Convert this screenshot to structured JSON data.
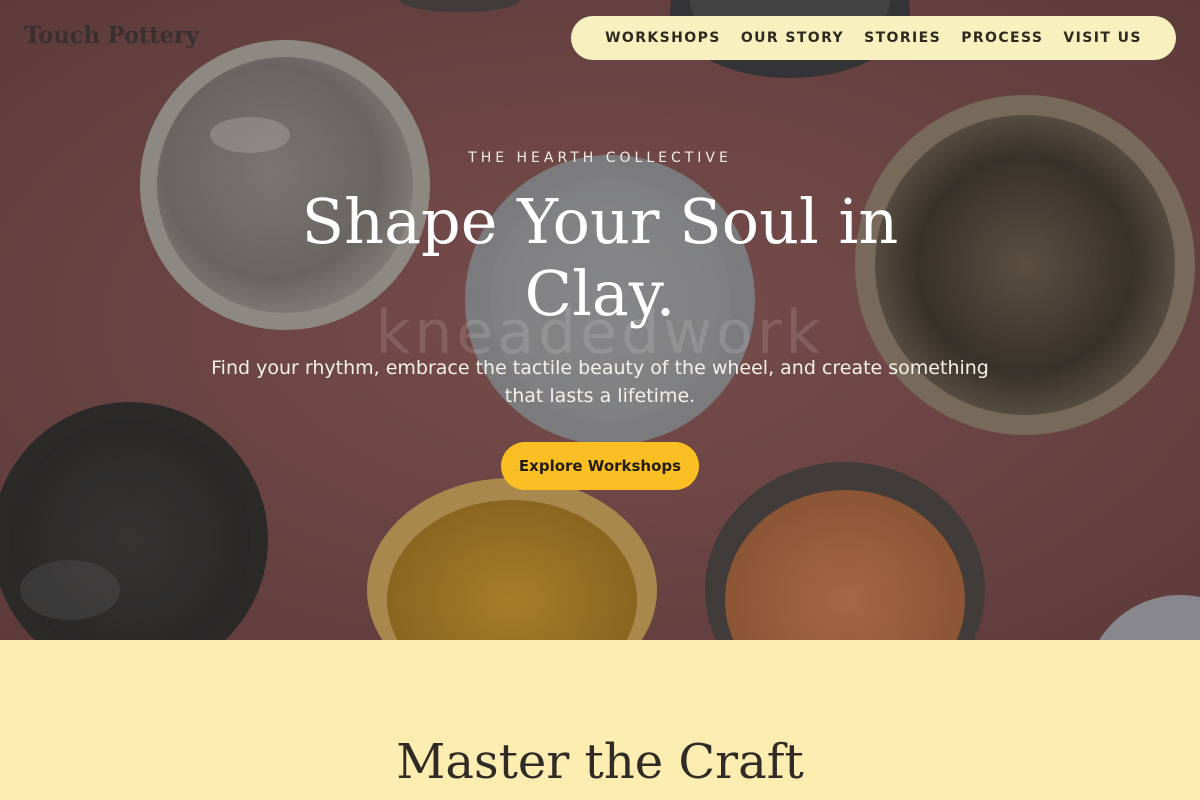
{
  "colors": {
    "nav_background": "#f8f1bf",
    "cta_background": "#fbbf24",
    "section_background": "#feedb0",
    "hero_background": "#7a4f4f"
  },
  "header": {
    "logo": "Touch Pottery",
    "nav": [
      {
        "label": "WORKSHOPS"
      },
      {
        "label": "OUR STORY"
      },
      {
        "label": "STORIES"
      },
      {
        "label": "PROCESS"
      },
      {
        "label": "VISIT US"
      }
    ]
  },
  "hero": {
    "image": "ceramic-bowls-on-terracotta-surface",
    "watermark": "kneadedwork",
    "eyebrow": "THE HEARTH COLLECTIVE",
    "headline": "Shape Your Soul in Clay.",
    "subtext": "Find your rhythm, embrace the tactile beauty of the wheel, and create something that lasts a lifetime.",
    "cta_label": "Explore Workshops"
  },
  "section": {
    "title": "Master the Craft"
  }
}
